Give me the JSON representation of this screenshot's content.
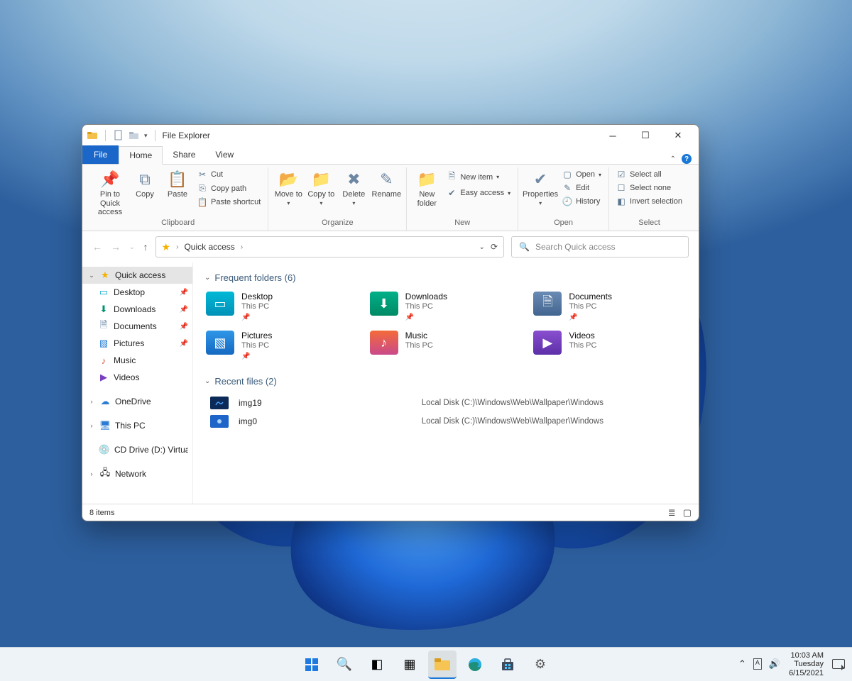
{
  "window": {
    "title": "File Explorer",
    "tabs": {
      "file": "File",
      "home": "Home",
      "share": "Share",
      "view": "View"
    },
    "ribbon": {
      "clipboard": {
        "label": "Clipboard",
        "pin": "Pin to Quick access",
        "copy": "Copy",
        "paste": "Paste",
        "cut": "Cut",
        "copy_path": "Copy path",
        "paste_shortcut": "Paste shortcut"
      },
      "organize": {
        "label": "Organize",
        "move_to": "Move to",
        "copy_to": "Copy to",
        "delete": "Delete",
        "rename": "Rename"
      },
      "new": {
        "label": "New",
        "new_folder": "New folder",
        "new_item": "New item",
        "easy_access": "Easy access"
      },
      "open": {
        "label": "Open",
        "properties": "Properties",
        "open": "Open",
        "edit": "Edit",
        "history": "History"
      },
      "select": {
        "label": "Select",
        "select_all": "Select all",
        "select_none": "Select none",
        "invert": "Invert selection"
      }
    },
    "address": {
      "location": "Quick access"
    },
    "search": {
      "placeholder": "Search Quick access"
    },
    "sidebar": {
      "quick_access": "Quick access",
      "items": [
        {
          "label": "Desktop"
        },
        {
          "label": "Downloads"
        },
        {
          "label": "Documents"
        },
        {
          "label": "Pictures"
        },
        {
          "label": "Music"
        },
        {
          "label": "Videos"
        }
      ],
      "onedrive": "OneDrive",
      "this_pc": "This PC",
      "cd_drive": "CD Drive (D:) VirtualE",
      "network": "Network"
    },
    "content": {
      "frequent_label": "Frequent folders (6)",
      "frequent": [
        {
          "name": "Desktop",
          "sub": "This PC"
        },
        {
          "name": "Downloads",
          "sub": "This PC"
        },
        {
          "name": "Documents",
          "sub": "This PC"
        },
        {
          "name": "Pictures",
          "sub": "This PC"
        },
        {
          "name": "Music",
          "sub": "This PC"
        },
        {
          "name": "Videos",
          "sub": "This PC"
        }
      ],
      "recent_label": "Recent files (2)",
      "recent": [
        {
          "name": "img19",
          "path": "Local Disk (C:)\\Windows\\Web\\Wallpaper\\Windows"
        },
        {
          "name": "img0",
          "path": "Local Disk (C:)\\Windows\\Web\\Wallpaper\\Windows"
        }
      ]
    },
    "status": {
      "items": "8 items"
    }
  },
  "taskbar": {
    "time": "10:03 AM",
    "day": "Tuesday",
    "date": "6/15/2021"
  }
}
